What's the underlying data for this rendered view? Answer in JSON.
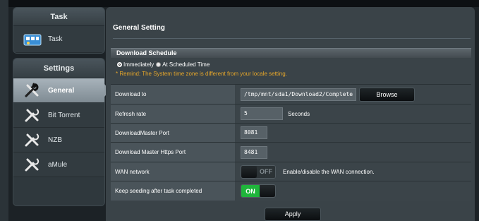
{
  "sidebar": {
    "task_panel": {
      "header": "Task",
      "items": [
        {
          "label": "Task",
          "icon": "task-icon",
          "active": false
        }
      ]
    },
    "settings_panel": {
      "header": "Settings",
      "items": [
        {
          "label": "General",
          "icon": "wrench-icon",
          "active": true
        },
        {
          "label": "Bit Torrent",
          "icon": "wrench-icon",
          "active": false
        },
        {
          "label": "NZB",
          "icon": "wrench-icon",
          "active": false
        },
        {
          "label": "aMule",
          "icon": "wrench-icon",
          "active": false
        }
      ]
    }
  },
  "main": {
    "title": "General Setting",
    "section": {
      "header": "Download Schedule",
      "radio_immediately": "Immediately",
      "radio_scheduled": "At Scheduled Time",
      "selected": "Immediately",
      "remind": "* Remind: The System time zone is different from your locale setting."
    },
    "fields": {
      "download_to": {
        "label": "Download to",
        "value": "/tmp/mnt/sda1/Download2/Complete",
        "button": "Browse"
      },
      "refresh_rate": {
        "label": "Refresh rate",
        "value": "5",
        "unit": "Seconds"
      },
      "dm_port": {
        "label": "DownloadMaster Port",
        "value": "8081"
      },
      "dm_https_port": {
        "label": "Download Master Https Port",
        "value": "8481"
      },
      "wan_network": {
        "label": "WAN network",
        "state": "OFF",
        "hint": "Enable/disable the WAN connection."
      },
      "keep_seeding": {
        "label": "Keep seeding after task completed",
        "state": "ON"
      }
    },
    "apply_label": "Apply"
  },
  "colors": {
    "toggle_on": "#1fb53b",
    "remind_text": "#e5a62a",
    "active_item": "#8f9aa2"
  }
}
